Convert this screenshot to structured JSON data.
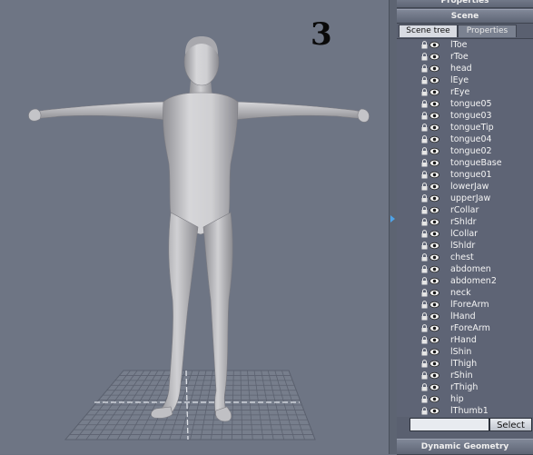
{
  "viewport": {
    "step_number": "3"
  },
  "panel": {
    "properties_header": "Properties",
    "scene_header": "Scene",
    "tabs": [
      "Scene tree",
      "Properties"
    ],
    "active_tab": "Scene tree",
    "tree_items": [
      "lToe",
      "rToe",
      "head",
      "lEye",
      "rEye",
      "tongue05",
      "tongue03",
      "tongueTip",
      "tongue04",
      "tongue02",
      "tongueBase",
      "tongue01",
      "lowerJaw",
      "upperJaw",
      "rCollar",
      "rShldr",
      "lCollar",
      "lShldr",
      "chest",
      "abdomen",
      "abdomen2",
      "neck",
      "lForeArm",
      "lHand",
      "rForeArm",
      "rHand",
      "lShin",
      "lThigh",
      "rShin",
      "rThigh",
      "hip",
      "lThumb1"
    ],
    "search_value": "",
    "select_button": "Select",
    "dynamic_geometry_header": "Dynamic Geometry"
  },
  "colors": {
    "viewport_bg": "#6e7584",
    "panel_bg": "#5a6070",
    "accent": "#4fa3e8"
  }
}
